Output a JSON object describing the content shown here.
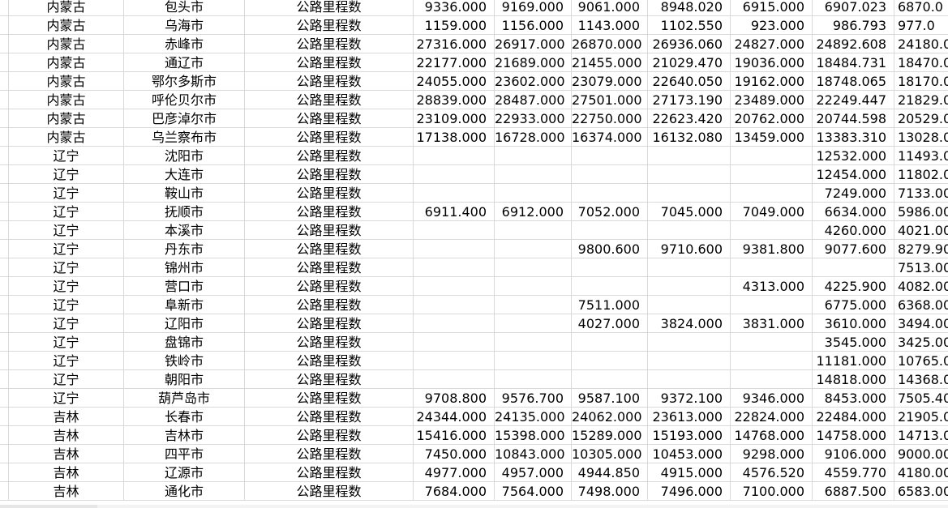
{
  "column_header": "公路里程数",
  "rows": [
    {
      "province": "内蒙古",
      "city": "包头市",
      "metric": "公路里程数",
      "v": [
        "9336.000",
        "9169.000",
        "9061.000",
        "8948.020",
        "6915.000",
        "6907.023",
        "6870.0"
      ]
    },
    {
      "province": "内蒙古",
      "city": "乌海市",
      "metric": "公路里程数",
      "v": [
        "1159.000",
        "1156.000",
        "1143.000",
        "1102.550",
        "923.000",
        "986.793",
        "977.0"
      ]
    },
    {
      "province": "内蒙古",
      "city": "赤峰市",
      "metric": "公路里程数",
      "v": [
        "27316.000",
        "26917.000",
        "26870.000",
        "26936.060",
        "24827.000",
        "24892.608",
        "24180.0"
      ]
    },
    {
      "province": "内蒙古",
      "city": "通辽市",
      "metric": "公路里程数",
      "v": [
        "22177.000",
        "21689.000",
        "21455.000",
        "21029.470",
        "19036.000",
        "18484.731",
        "18470.0"
      ]
    },
    {
      "province": "内蒙古",
      "city": "鄂尔多斯市",
      "metric": "公路里程数",
      "v": [
        "24055.000",
        "23602.000",
        "23079.000",
        "22640.050",
        "19162.000",
        "18748.065",
        "18170.0"
      ]
    },
    {
      "province": "内蒙古",
      "city": "呼伦贝尔市",
      "metric": "公路里程数",
      "v": [
        "28839.000",
        "28487.000",
        "27501.000",
        "27173.190",
        "23489.000",
        "22249.447",
        "21829.0"
      ]
    },
    {
      "province": "内蒙古",
      "city": "巴彦淖尔市",
      "metric": "公路里程数",
      "v": [
        "23109.000",
        "22933.000",
        "22750.000",
        "22623.420",
        "20762.000",
        "20744.598",
        "20529.0"
      ]
    },
    {
      "province": "内蒙古",
      "city": "乌兰察布市",
      "metric": "公路里程数",
      "v": [
        "17138.000",
        "16728.000",
        "16374.000",
        "16132.080",
        "13459.000",
        "13383.310",
        "13028.0"
      ]
    },
    {
      "province": "辽宁",
      "city": "沈阳市",
      "metric": "公路里程数",
      "v": [
        "",
        "",
        "",
        "",
        "",
        "12532.000",
        "11493.0"
      ]
    },
    {
      "province": "辽宁",
      "city": "大连市",
      "metric": "公路里程数",
      "v": [
        "",
        "",
        "",
        "",
        "",
        "12454.000",
        "11802.0"
      ]
    },
    {
      "province": "辽宁",
      "city": "鞍山市",
      "metric": "公路里程数",
      "v": [
        "",
        "",
        "",
        "",
        "",
        "7249.000",
        "7133.00"
      ]
    },
    {
      "province": "辽宁",
      "city": "抚顺市",
      "metric": "公路里程数",
      "v": [
        "6911.400",
        "6912.000",
        "7052.000",
        "7045.000",
        "7049.000",
        "6634.000",
        "5986.00"
      ]
    },
    {
      "province": "辽宁",
      "city": "本溪市",
      "metric": "公路里程数",
      "v": [
        "",
        "",
        "",
        "",
        "",
        "4260.000",
        "4021.00"
      ]
    },
    {
      "province": "辽宁",
      "city": "丹东市",
      "metric": "公路里程数",
      "v": [
        "",
        "",
        "9800.600",
        "9710.600",
        "9381.800",
        "9077.600",
        "8279.90"
      ]
    },
    {
      "province": "辽宁",
      "city": "锦州市",
      "metric": "公路里程数",
      "v": [
        "",
        "",
        "",
        "",
        "",
        "",
        "7513.00"
      ]
    },
    {
      "province": "辽宁",
      "city": "营口市",
      "metric": "公路里程数",
      "v": [
        "",
        "",
        "",
        "",
        "4313.000",
        "4225.900",
        "4082.00"
      ]
    },
    {
      "province": "辽宁",
      "city": "阜新市",
      "metric": "公路里程数",
      "v": [
        "",
        "",
        "7511.000",
        "",
        "",
        "6775.000",
        "6368.00"
      ]
    },
    {
      "province": "辽宁",
      "city": "辽阳市",
      "metric": "公路里程数",
      "v": [
        "",
        "",
        "4027.000",
        "3824.000",
        "3831.000",
        "3610.000",
        "3494.00"
      ]
    },
    {
      "province": "辽宁",
      "city": "盘锦市",
      "metric": "公路里程数",
      "v": [
        "",
        "",
        "",
        "",
        "",
        "3545.000",
        "3425.00"
      ]
    },
    {
      "province": "辽宁",
      "city": "铁岭市",
      "metric": "公路里程数",
      "v": [
        "",
        "",
        "",
        "",
        "",
        "11181.000",
        "10765.0"
      ]
    },
    {
      "province": "辽宁",
      "city": "朝阳市",
      "metric": "公路里程数",
      "v": [
        "",
        "",
        "",
        "",
        "",
        "14818.000",
        "14368.0"
      ]
    },
    {
      "province": "辽宁",
      "city": "葫芦岛市",
      "metric": "公路里程数",
      "v": [
        "9708.800",
        "9576.700",
        "9587.100",
        "9372.100",
        "9346.000",
        "8453.000",
        "7505.40"
      ]
    },
    {
      "province": "吉林",
      "city": "长春市",
      "metric": "公路里程数",
      "v": [
        "24344.000",
        "24135.000",
        "24062.000",
        "23613.000",
        "22824.000",
        "22484.000",
        "21905.0"
      ]
    },
    {
      "province": "吉林",
      "city": "吉林市",
      "metric": "公路里程数",
      "v": [
        "15416.000",
        "15398.000",
        "15289.000",
        "15193.000",
        "14768.000",
        "14758.000",
        "14713.0"
      ]
    },
    {
      "province": "吉林",
      "city": "四平市",
      "metric": "公路里程数",
      "v": [
        "7450.000",
        "10843.000",
        "10305.000",
        "10453.000",
        "9298.000",
        "9106.000",
        "9000.00"
      ]
    },
    {
      "province": "吉林",
      "city": "辽源市",
      "metric": "公路里程数",
      "v": [
        "4977.000",
        "4957.000",
        "4944.850",
        "4915.000",
        "4576.520",
        "4559.770",
        "4180.00"
      ]
    },
    {
      "province": "吉林",
      "city": "通化市",
      "metric": "公路里程数",
      "v": [
        "7684.000",
        "7564.000",
        "7498.000",
        "7496.000",
        "7100.000",
        "6887.500",
        "6583.00"
      ]
    }
  ]
}
